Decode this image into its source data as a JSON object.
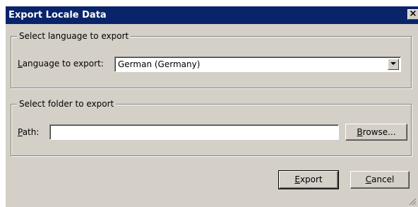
{
  "window": {
    "title": "Export Locale Data",
    "close_glyph": "×"
  },
  "language_group": {
    "legend": "Select language to export",
    "label_first": "L",
    "label_rest": "anguage to export:",
    "selected": "German (Germany)"
  },
  "folder_group": {
    "legend": "Select folder to export",
    "label_first": "P",
    "label_rest": "ath:",
    "path_value": "",
    "browse_first": "B",
    "browse_rest": "rowse..."
  },
  "buttons": {
    "export_first": "E",
    "export_rest": "xport",
    "cancel_first": "C",
    "cancel_rest": "ancel"
  },
  "colors": {
    "titlebar": "#0a246a",
    "face": "#d4d0c8"
  }
}
